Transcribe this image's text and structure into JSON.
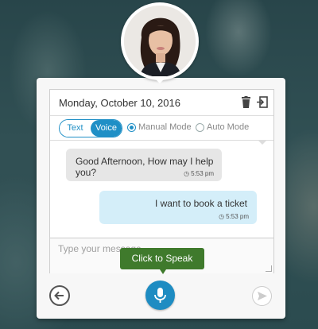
{
  "header": {
    "date": "Monday, October 10, 2016"
  },
  "mode": {
    "text_label": "Text",
    "voice_label": "Voice",
    "manual_label": "Manual Mode",
    "auto_label": "Auto Mode",
    "selected_toggle": "Voice",
    "selected_mode": "Manual Mode"
  },
  "messages": [
    {
      "sender": "bot",
      "text": "Good Afternoon, How may I help you?",
      "time": "5:53 pm"
    },
    {
      "sender": "user",
      "text": "I want to book a ticket",
      "time": "5:53 pm"
    }
  ],
  "composer": {
    "placeholder": "Type your message"
  },
  "speak_tooltip": "Click to Speak",
  "icons": {
    "trash": "trash-icon",
    "exit": "exit-icon",
    "back": "back-arrow-icon",
    "mic": "microphone-icon",
    "send": "send-icon",
    "clock": "clock-icon"
  },
  "colors": {
    "accent": "#1f8fc6",
    "tooltip": "#3f7a2c",
    "bot_bubble": "#e6e6e6",
    "user_bubble": "#d4eef9"
  }
}
